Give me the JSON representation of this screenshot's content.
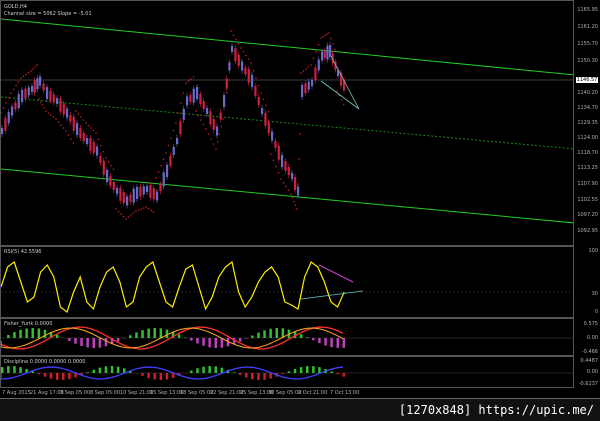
{
  "main": {
    "symbol": "GOLD,H4",
    "channel_info": "Channel size = 5062  Slope = -5.01",
    "current_price": "1146.57",
    "price_axis": [
      "1165.95",
      "1161.20",
      "1155.70",
      "1150.30",
      "1146.57",
      "1140.20",
      "1134.70",
      "1129.35",
      "1124.00",
      "1118.70",
      "1113.25",
      "1107.90",
      "1102.55",
      "1097.20",
      "1092.95"
    ]
  },
  "rsi": {
    "label": "RSI(5) 42.5596",
    "axis": [
      "100",
      "30",
      "0"
    ]
  },
  "fisher": {
    "label": "Fisher_Yurik 0.0000",
    "axis": [
      "0.575",
      "0.00",
      "-0.466"
    ]
  },
  "discipline": {
    "label": "Discipline 0.0000 0.0000 0.0000",
    "axis": [
      "0.4487",
      "0.00",
      "-0.6237"
    ]
  },
  "dates": [
    "7 Aug 2015",
    "21 Aug 17:00",
    "3 Sep 05:00",
    "8 Sep 05:00",
    "10 Sep 21:00",
    "15 Sep 13:00",
    "18 Sep 05:00",
    "22 Sep 21:00",
    "25 Sep 13:00",
    "30 Sep 05:00",
    "2 Oct 21:00",
    "7 Oct 13:00"
  ],
  "footer": {
    "text": "[1270x848] https://upic.me/"
  },
  "colors": {
    "up": "#6a6ac8",
    "down": "#d02040",
    "channel": "#22cc22",
    "rsi": "#ffee00",
    "sar": "#cc2020"
  }
}
